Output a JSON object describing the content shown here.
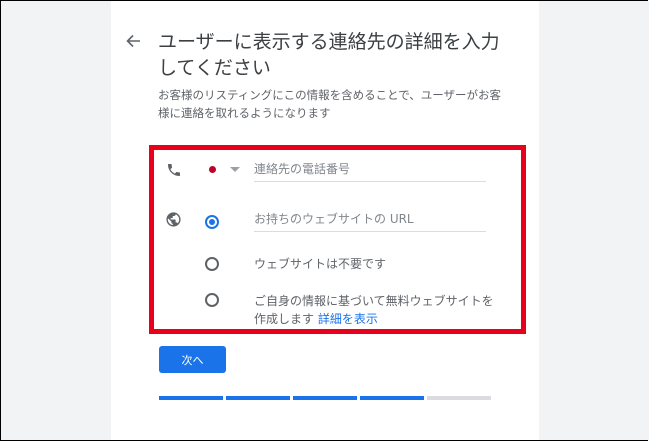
{
  "header": {
    "title": "ユーザーに表示する連絡先の詳細を入力してください",
    "description": "お客様のリスティングにこの情報を含めることで、ユーザーがお客様に連絡を取れるようになります"
  },
  "phone": {
    "icon": "phone-icon",
    "country_flag_color": "#c2002a",
    "placeholder": "連絡先の電話番号"
  },
  "website": {
    "icon": "globe-icon",
    "options": [
      {
        "placeholder": "お持ちのウェブサイトの URL",
        "selected": true
      },
      {
        "label": "ウェブサイトは不要です",
        "selected": false
      },
      {
        "label": "ご自身の情報に基づいて無料ウェブサイトを作成します",
        "link": "詳細を表示",
        "selected": false
      }
    ]
  },
  "actions": {
    "next_label": "次へ"
  },
  "progress": {
    "completed_steps": 4,
    "total_steps": 5
  },
  "colors": {
    "accent": "#1a73e8",
    "highlight": "#e8001c",
    "gutter": "#f1f3f4"
  }
}
